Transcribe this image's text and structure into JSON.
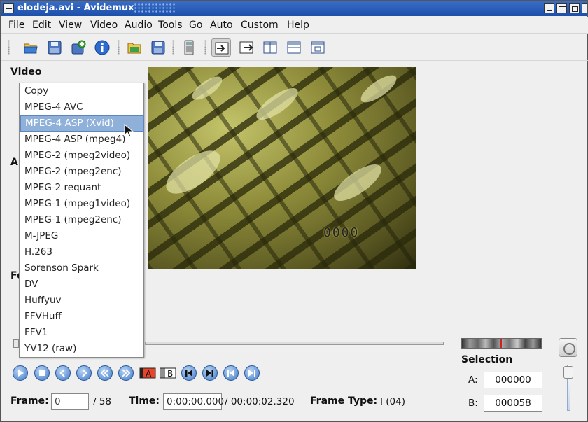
{
  "window": {
    "title": "elodeja.avi - Avidemux"
  },
  "menubar": {
    "items": [
      "File",
      "Edit",
      "View",
      "Video",
      "Audio",
      "Tools",
      "Go",
      "Auto",
      "Custom",
      "Help"
    ]
  },
  "toolbar": {
    "icons": [
      "open-folder-icon",
      "save-icon",
      "append-icon",
      "info-icon",
      "open-image-folder-icon",
      "save-image-icon",
      "calculator-icon",
      "input-view-icon",
      "output-view-icon",
      "side-by-side-view-icon",
      "top-bottom-view-icon",
      "separate-view-icon"
    ],
    "pressed": "input-view-icon"
  },
  "sections": {
    "video_label": "Video",
    "audio_label_partial": "Au",
    "format_label_partial": "Fo"
  },
  "video_codec_dropdown": {
    "options": [
      "Copy",
      "MPEG-4 AVC",
      "MPEG-4 ASP (Xvid)",
      "MPEG-4 ASP (mpeg4)",
      "MPEG-2 (mpeg2video)",
      "MPEG-2 (mpeg2enc)",
      "MPEG-2 requant",
      "MPEG-1 (mpeg1video)",
      "MPEG-1 (mpeg2enc)",
      "M-JPEG",
      "H.263",
      "Sorenson Spark",
      "DV",
      "Huffyuv",
      "FFVHuff",
      "FFV1",
      "YV12 (raw)"
    ],
    "selected_index": 2
  },
  "preview": {
    "overlay_counter": "0000"
  },
  "navigation": {
    "marker_a_label": "A",
    "marker_b_label": "B"
  },
  "status": {
    "frame_label": "Frame:",
    "frame_value": "0",
    "frame_total": "/ 58",
    "time_label": "Time:",
    "time_value": "0:00:00.000",
    "time_total": "/ 00:00:02.320",
    "frame_type_label": "Frame Type:",
    "frame_type_value": "I (04)"
  },
  "selection": {
    "title": "Selection",
    "a_label": "A:",
    "a_value": "000000",
    "b_label": "B:",
    "b_value": "000058"
  },
  "colors": {
    "titlebar": "#1c4faa",
    "selected_item": "#8fb0d9",
    "nav_button": "#3c78c8",
    "marker_a": "#e8442c"
  }
}
